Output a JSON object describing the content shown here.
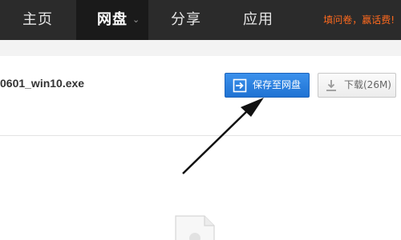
{
  "nav": {
    "home": "主页",
    "disk": "网盘",
    "share": "分享",
    "app": "应用",
    "promo": "填问卷，赢话费!"
  },
  "file": {
    "name": "0601_win10.exe"
  },
  "actions": {
    "save_label": "保存至网盘",
    "download_label": "下载(26M)"
  },
  "icons": {
    "disk_menu": "chevron-down-icon",
    "save": "save-to-disk-icon",
    "download": "download-icon",
    "file": "document-icon",
    "annotation": "arrow-pointer-icon"
  },
  "colors": {
    "nav_bg": "#2b2b2b",
    "promo": "#ff6a1e",
    "save_button": "#2a7fe0"
  }
}
